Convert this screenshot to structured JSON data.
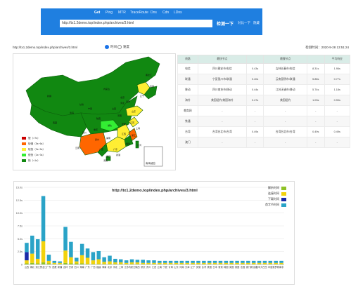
{
  "nav": {
    "tabs": [
      {
        "label": "Get",
        "active": true
      },
      {
        "label": "Ping",
        "active": false
      },
      {
        "label": "MTR",
        "active": false
      },
      {
        "label": "TraceRoute",
        "active": false
      },
      {
        "label": "Dns",
        "active": false
      },
      {
        "label": "Cdn",
        "active": false
      },
      {
        "label": "LDns",
        "active": false
      }
    ],
    "url_value": "http://tx1.2demo.top/index.php/archives/3.html",
    "check_label": "检测一下",
    "link1": "对比一下",
    "link2": "隐藏"
  },
  "info": {
    "url": "http://tx1.2demo.top/index.php/archives/3.html",
    "radio_option1": "时间",
    "radio_option2": "速度",
    "check_time": "检测时间：2020-9-28 13:51:24"
  },
  "map": {
    "legend": [
      {
        "label": "慢（>7s）",
        "color": "#cc0000"
      },
      {
        "label": "较慢（5s~6s）",
        "color": "#ff6600"
      },
      {
        "label": "较快（3s~5s）",
        "color": "#ffee33"
      },
      {
        "label": "很快（1s~3s）",
        "color": "#33ee33"
      },
      {
        "label": "快（<1s）",
        "color": "#118811"
      }
    ],
    "inset_label": "南海诸岛",
    "provinces": [
      "新疆",
      "西藏",
      "青海",
      "甘肃",
      "内蒙古",
      "黑龙江",
      "吉林",
      "辽宁",
      "四川",
      "云南",
      "广西",
      "广东",
      "福建",
      "江西",
      "浙江",
      "江苏",
      "山东",
      "河南",
      "湖北",
      "湖南",
      "贵州",
      "重庆",
      "陕西",
      "山西",
      "河北",
      "宁夏",
      "安徽",
      "上海",
      "北京",
      "天津",
      "澳门",
      "香港",
      "台湾",
      "海南"
    ]
  },
  "table": {
    "headers": [
      "线路",
      "最快节点",
      "",
      "最慢节点",
      "",
      "平均响应"
    ],
    "rows": [
      [
        "电信",
        "四川雅安市/电信",
        "0.43s",
        "吉林长春市/电信",
        "8.31s",
        "1.96s"
      ],
      [
        "联通",
        "宁夏银川市/联通",
        "0.40s",
        "云南昆明市/联通",
        "5.88s",
        "0.77s"
      ],
      [
        "移动",
        "四川南充市/移动",
        "0.44s",
        "江苏无锡市/移动",
        "5.74s",
        "1.18s"
      ],
      [
        "海外",
        "美国纽约/美国海外",
        "0.47s",
        "美国纽约",
        "1.03s",
        "0.90s"
      ],
      [
        "教育网",
        "-",
        "-",
        "-",
        "-",
        "-"
      ],
      [
        "铁通",
        "-",
        "-",
        "-",
        "-",
        "-"
      ],
      [
        "台湾",
        "台湾台北市/台湾",
        "0.49s",
        "台湾台北市/台湾",
        "0.49s",
        "0.49s"
      ],
      [
        "澳门",
        "-",
        "-",
        "-",
        "-",
        "-"
      ]
    ]
  },
  "chart_data": {
    "type": "bar",
    "stacked": true,
    "title": "http://tx1.2demo.top/index.php/archives/3.html",
    "ylim": [
      0,
      15
    ],
    "y_ticks": [
      "0",
      "2.5s",
      "5.0s",
      "7.5s",
      "10.0s",
      "12.5s",
      "15.0s"
    ],
    "legend_position": "top-right",
    "x_labels": [
      "山西",
      "湖北",
      "浙江",
      "黑龙江",
      "广东",
      "西藏",
      "新疆",
      "吉林",
      "甘肃",
      "四川",
      "湖南",
      "广东",
      "广西",
      "福建",
      "海南",
      "北京",
      "河北",
      "上海",
      "江苏",
      "内蒙古",
      "陕西",
      "重庆",
      "贵州",
      "江西",
      "云南",
      "宁夏",
      "青海",
      "山东",
      "河南",
      "天津",
      "辽宁",
      "安徽",
      "台湾",
      "美国",
      "日本",
      "香港",
      "韩国",
      "英国",
      "德国",
      "法国",
      "澳门",
      "新加坡",
      "加拿大",
      "巴西",
      "印度",
      "俄罗斯",
      "南非"
    ],
    "series": [
      {
        "name": "解析时间",
        "color": "#8fc226",
        "values": [
          0.2,
          0.3,
          0.2,
          0.4,
          0.2,
          0.1,
          0.1,
          0.3,
          0.2,
          0.2,
          0.2,
          0.1,
          0.1,
          0.1,
          0.1,
          0.1,
          0.1,
          0.1,
          0.1,
          0.1,
          0.1,
          0.1,
          0.1,
          0.1,
          0.1,
          0.1,
          0.1,
          0.1,
          0.1,
          0.1,
          0.1,
          0.1,
          0.1,
          0.1,
          0.1,
          0.1,
          0.1,
          0.1,
          0.1,
          0.1,
          0.1,
          0.1,
          0.1,
          0.1,
          0.1,
          0.1,
          0.1
        ]
      },
      {
        "name": "连接时间",
        "color": "#f2d20c",
        "values": [
          0.6,
          1.8,
          0.9,
          4.1,
          0.5,
          0.2,
          0.2,
          2.4,
          1.2,
          0.4,
          1.6,
          1.2,
          0.7,
          0.9,
          0.4,
          0.5,
          0.3,
          0.3,
          0.2,
          0.3,
          0.3,
          0.2,
          0.2,
          0.2,
          0.2,
          0.2,
          0.2,
          0.2,
          0.2,
          0.2,
          0.2,
          0.2,
          0.2,
          0.2,
          0.2,
          0.2,
          0.2,
          0.2,
          0.2,
          0.2,
          0.2,
          0.2,
          0.2,
          0.2,
          0.2,
          0.2,
          0.2
        ]
      },
      {
        "name": "下载时间",
        "color": "#1a2aa8",
        "values": [
          1.6,
          0,
          0,
          0,
          0,
          0,
          0,
          0,
          0,
          0,
          0,
          0,
          0,
          0,
          0,
          0,
          0,
          0,
          0,
          0,
          0,
          0,
          0,
          0,
          0,
          0,
          0,
          0,
          0,
          0,
          0,
          0,
          0,
          0,
          0,
          0,
          0,
          0,
          0,
          0,
          0,
          0,
          0,
          0,
          0,
          0,
          0
        ]
      },
      {
        "name": "首字节时间",
        "color": "#2aa3c7",
        "values": [
          1.8,
          3.5,
          3.8,
          8.8,
          1.2,
          0.4,
          0.3,
          4.6,
          3.0,
          0.7,
          2.2,
          1.8,
          1.6,
          1.6,
          0.9,
          1.1,
          0.7,
          0.6,
          0.5,
          0.6,
          0.5,
          0.6,
          0.5,
          0.5,
          0.4,
          0.4,
          0.4,
          0.4,
          0.4,
          0.4,
          0.4,
          0.4,
          0.4,
          0.4,
          0.4,
          0.4,
          0.4,
          0.4,
          0.4,
          0.4,
          0.4,
          0.4,
          0.4,
          0.4,
          0.4,
          0.4,
          0.4
        ]
      }
    ]
  }
}
